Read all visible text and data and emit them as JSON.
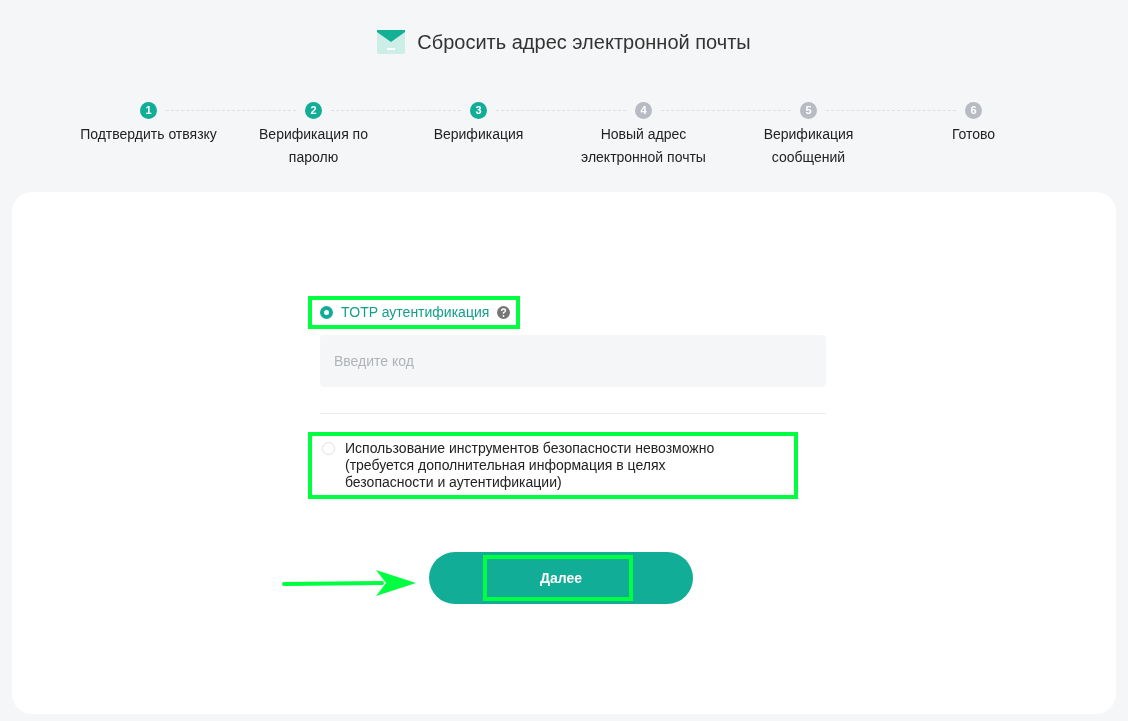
{
  "header": {
    "title": "Сбросить адрес электронной почты"
  },
  "steps": [
    {
      "number": "1",
      "label": "Подтвердить отвязку",
      "done": true
    },
    {
      "number": "2",
      "label": "Верификация по паролю",
      "done": true
    },
    {
      "number": "3",
      "label": "Верификация",
      "done": true
    },
    {
      "number": "4",
      "label": "Новый адрес электронной почты",
      "done": false
    },
    {
      "number": "5",
      "label": "Верификация сообщений",
      "done": false
    },
    {
      "number": "6",
      "label": "Готово",
      "done": false
    }
  ],
  "options": [
    {
      "label": "TOTP аутентификация",
      "selected": true,
      "help": true,
      "placeholder": "Введите код"
    },
    {
      "label": "Использование инструментов безопасности невозможно (требуется дополнительная информация в целях безопасности и аутентификации)",
      "selected": false,
      "help": false
    }
  ],
  "next_button": "Далее"
}
